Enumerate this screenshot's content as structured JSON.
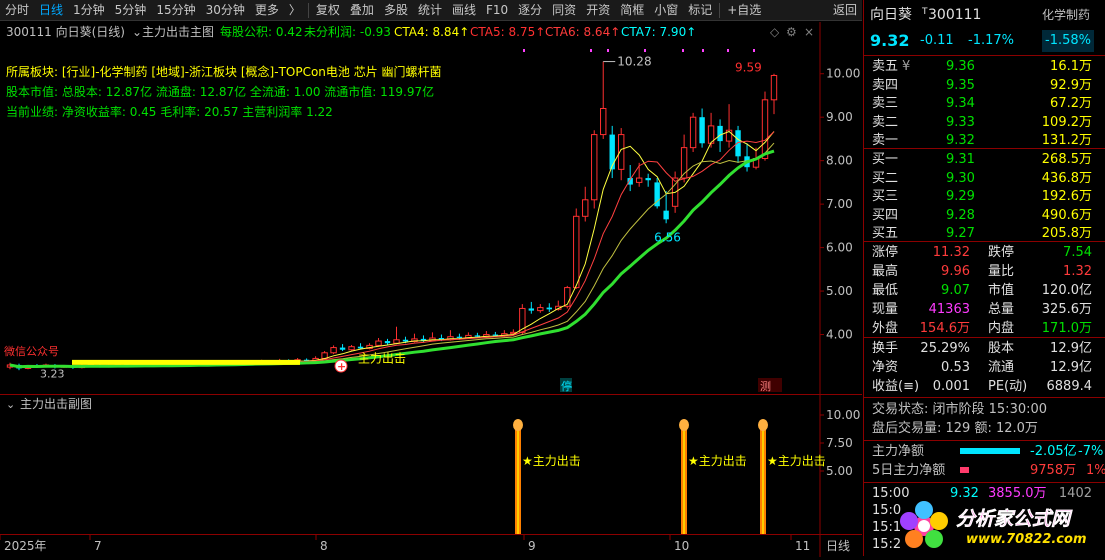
{
  "toolbar": {
    "items": [
      "分时",
      "日线",
      "1分钟",
      "5分钟",
      "15分钟",
      "30分钟",
      "更多",
      "复权",
      "叠加",
      "多股",
      "统计",
      "画线",
      "F10",
      "逐分",
      "同资",
      "开资",
      "简框",
      "小窗",
      "标记",
      "+自选",
      "返回"
    ],
    "more_caret": "〉"
  },
  "main_header": {
    "code_name": "300111 向日葵(日线)",
    "indicator": "主力出击主图",
    "eps": "每股公积: 0.42",
    "undist": "未分利润: -0.93",
    "cta4": "CTA4: 8.84↑",
    "cta5": "CTA5: 8.75↑",
    "cta6": "CTA6: 8.64↑",
    "cta7": "CTA7: 7.90↑"
  },
  "info_lines": {
    "sector": "所属板块: [行业]-化学制药 [地域]-浙江板块 [概念]-TOPCon电池 芯片 幽门螺杆菌",
    "capital": "股本市值: 总股本: 12.87亿 流通盘: 12.87亿 全流通: 1.00 流通市值: 119.97亿",
    "perf": "当前业绩:  净资收益率: 0.45 毛利率: 20.57 主营利润率 1.22"
  },
  "chart_labels": {
    "high_label": "10.28",
    "peak_label": "9.59",
    "low_label": "6.56",
    "low_left_label": "3.23",
    "left_tag": "微信公众号",
    "signal_main": "主力出击",
    "stop_tag": "停",
    "event_tag": "测",
    "subchart_title": "主力出击副图",
    "sub_signal": "★主力出击"
  },
  "y_axis_main": [
    "10.00",
    "9.00",
    "8.00",
    "7.00",
    "6.00",
    "5.00",
    "4.00"
  ],
  "y_axis_sub": [
    "10.00",
    "7.50",
    "5.00"
  ],
  "x_axis": {
    "labels": [
      "2025年",
      "7",
      "8",
      "9",
      "10",
      "11"
    ],
    "right": "日线"
  },
  "chart_data": {
    "type": "candlestick",
    "ylim": [
      3.0,
      10.5
    ],
    "candles": [
      [
        3.25,
        3.3,
        3.35,
        3.2
      ],
      [
        3.3,
        3.22,
        3.33,
        3.18
      ],
      [
        3.22,
        3.28,
        3.3,
        3.2
      ],
      [
        3.28,
        3.26,
        3.32,
        3.23
      ],
      [
        3.26,
        3.3,
        3.33,
        3.24
      ],
      [
        3.3,
        3.25,
        3.32,
        3.22
      ],
      [
        3.25,
        3.27,
        3.3,
        3.23
      ],
      [
        3.27,
        3.24,
        3.29,
        3.21
      ],
      [
        3.24,
        3.28,
        3.31,
        3.22
      ],
      [
        3.28,
        3.3,
        3.34,
        3.25
      ],
      [
        3.3,
        3.26,
        3.32,
        3.24
      ],
      [
        3.26,
        3.29,
        3.31,
        3.24
      ],
      [
        3.29,
        3.31,
        3.35,
        3.27
      ],
      [
        3.31,
        3.28,
        3.33,
        3.26
      ],
      [
        3.28,
        3.3,
        3.34,
        3.26
      ],
      [
        3.3,
        3.32,
        3.36,
        3.28
      ],
      [
        3.32,
        3.29,
        3.34,
        3.27
      ],
      [
        3.29,
        3.31,
        3.33,
        3.27
      ],
      [
        3.31,
        3.33,
        3.38,
        3.29
      ],
      [
        3.33,
        3.3,
        3.35,
        3.28
      ],
      [
        3.3,
        3.34,
        3.37,
        3.28
      ],
      [
        3.34,
        3.32,
        3.38,
        3.3
      ],
      [
        3.32,
        3.35,
        3.4,
        3.3
      ],
      [
        3.35,
        3.33,
        3.38,
        3.31
      ],
      [
        3.33,
        3.36,
        3.4,
        3.31
      ],
      [
        3.36,
        3.34,
        3.39,
        3.32
      ],
      [
        3.34,
        3.37,
        3.41,
        3.32
      ],
      [
        3.37,
        3.35,
        3.4,
        3.33
      ],
      [
        3.35,
        3.38,
        3.42,
        3.33
      ],
      [
        3.38,
        3.36,
        3.41,
        3.34
      ],
      [
        3.36,
        3.4,
        3.44,
        3.34
      ],
      [
        3.4,
        3.38,
        3.43,
        3.36
      ],
      [
        3.38,
        3.42,
        3.46,
        3.36
      ],
      [
        3.42,
        3.4,
        3.45,
        3.38
      ],
      [
        3.4,
        3.45,
        3.5,
        3.38
      ],
      [
        3.45,
        3.58,
        3.62,
        3.43
      ],
      [
        3.58,
        3.7,
        3.75,
        3.55
      ],
      [
        3.7,
        3.65,
        3.78,
        3.62
      ],
      [
        3.65,
        3.72,
        3.76,
        3.63
      ],
      [
        3.72,
        3.68,
        3.8,
        3.66
      ],
      [
        3.68,
        3.75,
        3.8,
        3.66
      ],
      [
        3.75,
        3.85,
        3.92,
        3.72
      ],
      [
        3.85,
        3.8,
        3.9,
        3.76
      ],
      [
        3.8,
        3.88,
        4.18,
        3.78
      ],
      [
        3.88,
        3.84,
        3.95,
        3.8
      ],
      [
        3.84,
        3.9,
        4.02,
        3.82
      ],
      [
        3.9,
        3.86,
        3.98,
        3.83
      ],
      [
        3.86,
        3.92,
        4.05,
        3.84
      ],
      [
        3.92,
        3.88,
        4.0,
        3.85
      ],
      [
        3.88,
        3.95,
        4.1,
        3.86
      ],
      [
        3.95,
        3.92,
        4.02,
        3.88
      ],
      [
        3.92,
        3.98,
        4.05,
        3.9
      ],
      [
        3.98,
        3.95,
        4.04,
        3.92
      ],
      [
        3.95,
        4.0,
        4.08,
        3.93
      ],
      [
        4.0,
        3.97,
        4.06,
        3.94
      ],
      [
        3.97,
        4.02,
        4.1,
        3.95
      ],
      [
        4.02,
        4.05,
        4.12,
        3.98
      ],
      [
        4.05,
        4.6,
        4.7,
        4.0
      ],
      [
        4.6,
        4.55,
        4.75,
        4.48
      ],
      [
        4.55,
        4.62,
        4.7,
        4.5
      ],
      [
        4.62,
        4.58,
        4.72,
        4.52
      ],
      [
        4.58,
        4.65,
        4.78,
        4.55
      ],
      [
        4.65,
        5.08,
        5.12,
        4.6
      ],
      [
        5.08,
        6.72,
        6.9,
        5.05
      ],
      [
        6.72,
        7.1,
        7.4,
        6.6
      ],
      [
        7.1,
        8.6,
        8.7,
        6.9
      ],
      [
        8.6,
        9.2,
        10.28,
        8.5
      ],
      [
        8.6,
        7.8,
        8.8,
        7.6
      ],
      [
        7.8,
        8.6,
        8.75,
        7.55
      ],
      [
        7.6,
        7.45,
        7.9,
        7.3
      ],
      [
        7.5,
        7.6,
        7.95,
        7.4
      ],
      [
        7.6,
        7.55,
        7.7,
        7.4
      ],
      [
        7.5,
        6.95,
        7.6,
        6.9
      ],
      [
        6.85,
        6.65,
        7.3,
        6.56
      ],
      [
        6.95,
        7.6,
        7.75,
        6.8
      ],
      [
        7.6,
        8.3,
        8.6,
        7.5
      ],
      [
        8.3,
        9.0,
        9.1,
        8.2
      ],
      [
        9.0,
        8.4,
        9.2,
        8.3
      ],
      [
        8.4,
        8.8,
        9.1,
        8.3
      ],
      [
        8.8,
        8.45,
        8.95,
        8.2
      ],
      [
        8.45,
        8.7,
        9.3,
        8.3
      ],
      [
        8.7,
        8.1,
        8.8,
        7.95
      ],
      [
        8.1,
        7.85,
        8.4,
        7.75
      ],
      [
        7.85,
        8.05,
        8.3,
        7.8
      ],
      [
        8.05,
        9.4,
        9.59,
        8.0
      ],
      [
        9.4,
        9.96,
        10.0,
        9.07
      ]
    ]
  },
  "quote": {
    "name": "向日葵",
    "code": "300111",
    "sector_tag": "化学制药",
    "price": "9.32",
    "change": "-0.11",
    "change_pct": "-1.17%",
    "sector_pct": "-1.58%",
    "asks": [
      {
        "label": "卖五",
        "mark": "¥",
        "price": "9.36",
        "vol": "16.1万"
      },
      {
        "label": "卖四",
        "mark": "",
        "price": "9.35",
        "vol": "92.9万"
      },
      {
        "label": "卖三",
        "mark": "",
        "price": "9.34",
        "vol": "67.2万"
      },
      {
        "label": "卖二",
        "mark": "",
        "price": "9.33",
        "vol": "109.2万"
      },
      {
        "label": "卖一",
        "mark": "",
        "price": "9.32",
        "vol": "131.2万"
      }
    ],
    "bids": [
      {
        "label": "买一",
        "price": "9.31",
        "vol": "268.5万"
      },
      {
        "label": "买二",
        "price": "9.30",
        "vol": "436.8万"
      },
      {
        "label": "买三",
        "price": "9.29",
        "vol": "192.6万"
      },
      {
        "label": "买四",
        "price": "9.28",
        "vol": "490.6万"
      },
      {
        "label": "买五",
        "price": "9.27",
        "vol": "205.8万"
      }
    ],
    "stats": [
      {
        "l1": "涨停",
        "v1": "11.32",
        "c1": "c-red",
        "l2": "跌停",
        "v2": "7.54",
        "c2": "c-green"
      },
      {
        "l1": "最高",
        "v1": "9.96",
        "c1": "c-red",
        "l2": "量比",
        "v2": "1.32",
        "c2": "c-red"
      },
      {
        "l1": "最低",
        "v1": "9.07",
        "c1": "c-green",
        "l2": "市值",
        "v2": "120.0亿",
        "c2": "c-white"
      },
      {
        "l1": "现量",
        "v1": "41363",
        "c1": "c-mag",
        "l2": "总量",
        "v2": "325.6万",
        "c2": "c-white"
      },
      {
        "l1": "外盘",
        "v1": "154.6万",
        "c1": "c-red",
        "l2": "内盘",
        "v2": "171.0万",
        "c2": "c-green"
      }
    ],
    "stats2": [
      {
        "l1": "换手",
        "v1": "25.29%",
        "l2": "股本",
        "v2": "12.9亿"
      },
      {
        "l1": "净资",
        "v1": "0.53",
        "l2": "流通",
        "v2": "12.9亿"
      },
      {
        "l1": "收益(≡)",
        "v1": "0.001",
        "l2": "PE(动)",
        "v2": "6889.4"
      }
    ],
    "trade_state": "交易状态: 闭市阶段 15:30:00",
    "after_hours": "盘后交易量: 129  额: 12.0万",
    "main_net": {
      "label": "主力净额",
      "value": "-2.05亿",
      "pct": "-7%"
    },
    "main_net5": {
      "label": "5日主力净额",
      "value": "9758万",
      "pct": "1%"
    },
    "ticks": [
      {
        "time": "15:00",
        "price": "9.32",
        "vol": "3855.0万",
        "n": "1402"
      },
      {
        "time": "15:0",
        "price": "",
        "vol": "",
        "n": ""
      },
      {
        "time": "15:1",
        "price": "",
        "vol": "",
        "n": ""
      },
      {
        "time": "15:2",
        "price": "",
        "vol": "",
        "n": ""
      }
    ]
  },
  "watermark": {
    "brand": "分析家公式网",
    "url": "www.70822.com"
  },
  "colors": {
    "up": "#ff3030",
    "down": "#00e5ff",
    "ma_yellow": "#ffff40",
    "ma_red": "#ff4040",
    "ma_green": "#30e030",
    "signal": "#ff3030",
    "axis": "#8b0000"
  }
}
